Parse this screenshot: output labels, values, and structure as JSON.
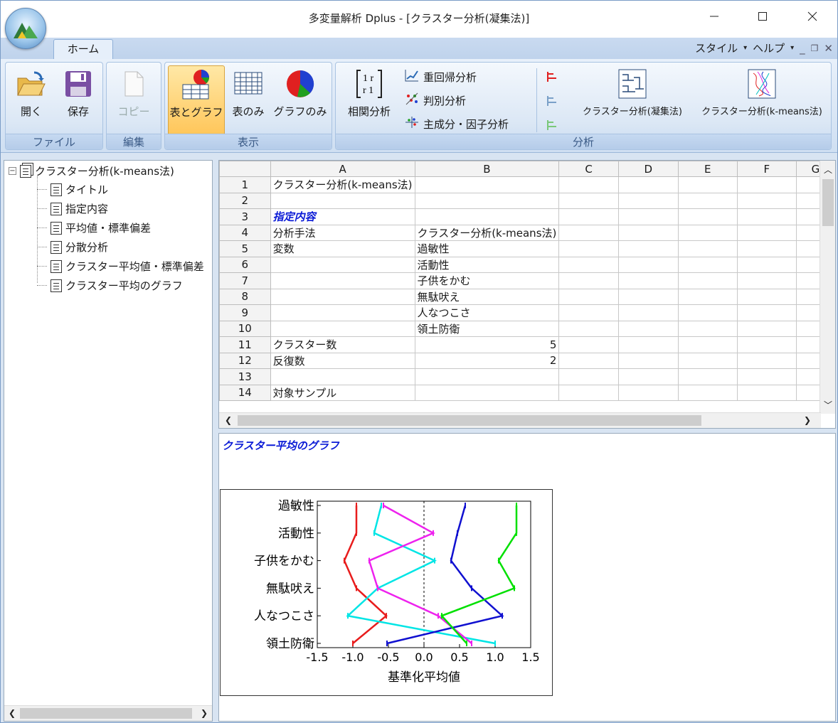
{
  "window": {
    "title": "多変量解析 Dplus - [クラスター分析(凝集法)]"
  },
  "tabs": {
    "home": "ホーム"
  },
  "menu": {
    "style": "スタイル",
    "help": "ヘルプ"
  },
  "ribbon": {
    "file": {
      "label": "ファイル",
      "open": "開く",
      "save": "保存"
    },
    "edit": {
      "label": "編集",
      "copy": "コピー"
    },
    "view": {
      "label": "表示",
      "table_graph": "表とグラフ",
      "table_only": "表のみ",
      "graph_only": "グラフのみ"
    },
    "analysis": {
      "label": "分析",
      "correlation": "相関分析",
      "regression": "重回帰分析",
      "discriminant": "判別分析",
      "pca": "主成分・因子分析",
      "cluster_agg": "クラスター分析(凝集法)",
      "cluster_kmeans": "クラスター分析(k-means法)"
    }
  },
  "tree": {
    "root": "クラスター分析(k-means法)",
    "items": [
      "タイトル",
      "指定内容",
      "平均値・標準偏差",
      "分散分析",
      "クラスター平均値・標準偏差",
      "クラスター平均のグラフ"
    ]
  },
  "grid": {
    "columns": [
      "A",
      "B",
      "C",
      "D",
      "E",
      "F",
      "G"
    ],
    "rows": [
      {
        "n": "1",
        "a": "クラスター分析(k-means法)",
        "b": ""
      },
      {
        "n": "2",
        "a": "",
        "b": ""
      },
      {
        "n": "3",
        "a": "指定内容",
        "b": "",
        "style": "head"
      },
      {
        "n": "4",
        "a": "分析手法",
        "b": "クラスター分析(k-means法)"
      },
      {
        "n": "5",
        "a": "変数",
        "b": "過敏性"
      },
      {
        "n": "6",
        "a": "",
        "b": "活動性"
      },
      {
        "n": "7",
        "a": "",
        "b": "子供をかむ"
      },
      {
        "n": "8",
        "a": "",
        "b": "無駄吠え"
      },
      {
        "n": "9",
        "a": "",
        "b": "人なつこさ"
      },
      {
        "n": "10",
        "a": "",
        "b": "領土防衛"
      },
      {
        "n": "11",
        "a": "クラスター数",
        "b": "5",
        "num": true
      },
      {
        "n": "12",
        "a": "反復数",
        "b": "2",
        "num": true
      },
      {
        "n": "13",
        "a": "",
        "b": ""
      },
      {
        "n": "14",
        "a": "対象サンプル",
        "b": ""
      }
    ]
  },
  "output": {
    "title": "クラスター平均のグラフ"
  },
  "chart_data": {
    "type": "line",
    "categories": [
      "過敏性",
      "活動性",
      "子供をかむ",
      "無駄吠え",
      "人なつこさ",
      "領土防衛"
    ],
    "xlabel": "基準化平均値",
    "xlim": [
      -1.5,
      1.5
    ],
    "xticks": [
      "-1.5",
      "-1.0",
      "-0.5",
      "0.0",
      "0.5",
      "1.0",
      "1.5"
    ],
    "series": [
      {
        "color": "#e81c1c",
        "values": [
          -0.95,
          -0.95,
          -1.12,
          -0.95,
          -0.53,
          -1.0
        ]
      },
      {
        "color": "#00e5e5",
        "values": [
          -0.6,
          -0.7,
          0.15,
          -0.65,
          -1.07,
          1.0
        ]
      },
      {
        "color": "#ee22ee",
        "values": [
          -0.57,
          0.13,
          -0.77,
          -0.65,
          0.2,
          0.67
        ]
      },
      {
        "color": "#1010d0",
        "values": [
          0.58,
          0.47,
          0.38,
          0.67,
          1.1,
          -0.52
        ]
      },
      {
        "color": "#00e000",
        "values": [
          1.3,
          1.3,
          1.05,
          1.27,
          0.25,
          0.6
        ]
      }
    ]
  }
}
